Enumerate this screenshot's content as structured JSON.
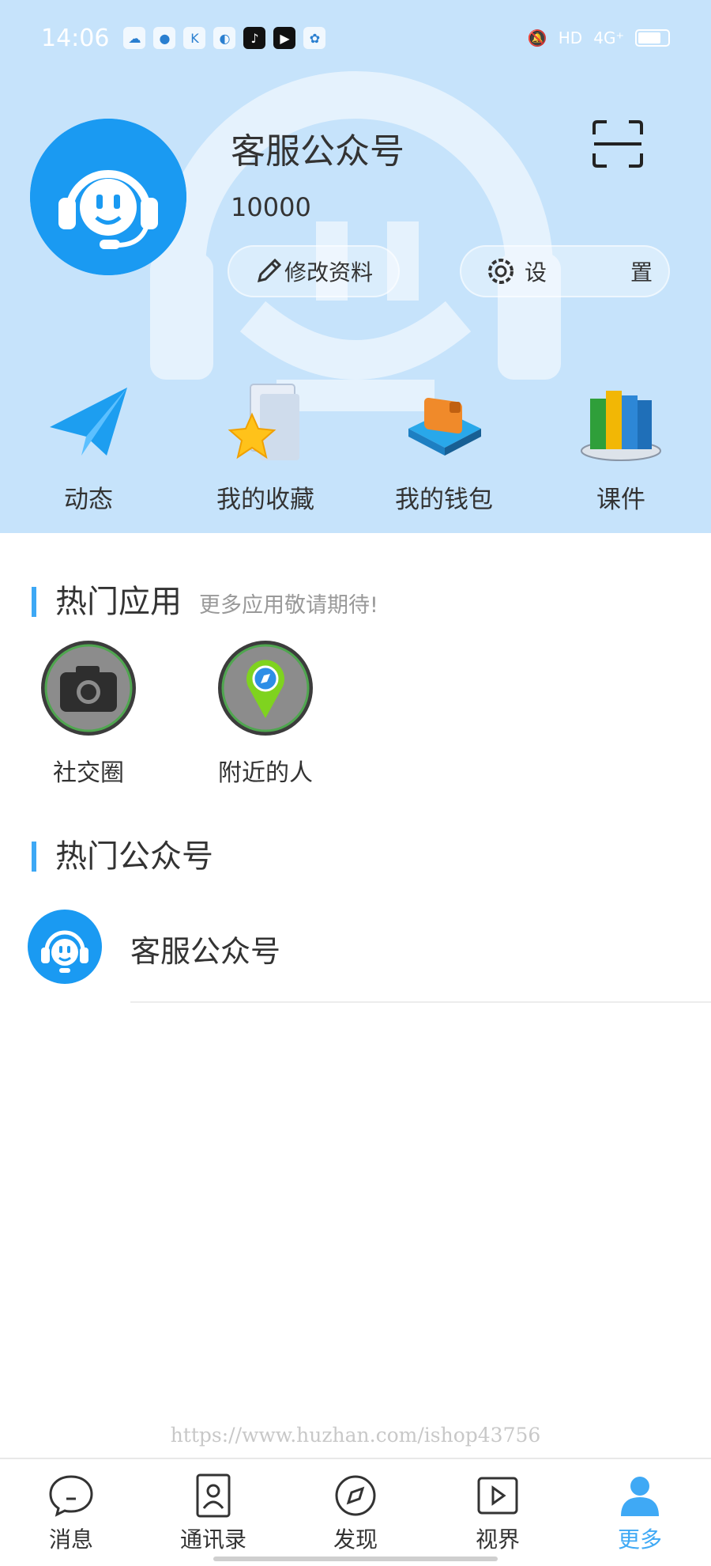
{
  "status_bar": {
    "time": "14:06",
    "network": "4G⁺",
    "hd": "HD"
  },
  "profile": {
    "name": "客服公众号",
    "id": "10000",
    "edit_label": "修改资料",
    "settings_char1": "设",
    "settings_char2": "置"
  },
  "quick_actions": [
    {
      "label": "动态"
    },
    {
      "label": "我的收藏"
    },
    {
      "label": "我的钱包"
    },
    {
      "label": "课件"
    }
  ],
  "hot_apps": {
    "title": "热门应用",
    "subtitle": "更多应用敬请期待!",
    "items": [
      {
        "label": "社交圈"
      },
      {
        "label": "附近的人"
      }
    ]
  },
  "hot_accounts": {
    "title": "热门公众号",
    "items": [
      {
        "name": "客服公众号"
      }
    ]
  },
  "watermark": "https://www.huzhan.com/ishop43756",
  "bottom_nav": [
    {
      "label": "消息"
    },
    {
      "label": "通讯录"
    },
    {
      "label": "发现"
    },
    {
      "label": "视界"
    },
    {
      "label": "更多"
    }
  ],
  "colors": {
    "accent": "#3fa9f5",
    "header_bg": "#c6e3fb",
    "avatar_blue": "#1a9af2"
  }
}
